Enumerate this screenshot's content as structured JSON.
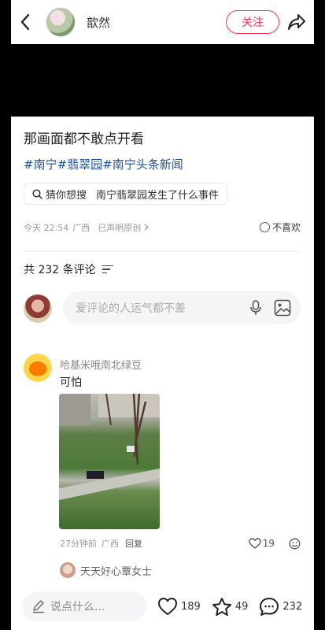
{
  "header": {
    "username": "歆然",
    "follow_label": "关注"
  },
  "post": {
    "title": "那画面都不敢点开看",
    "hashtags": [
      "#南宁",
      "#翡翠园",
      "#南宁头条新闻"
    ],
    "search_label": "猜你想搜",
    "search_query": "南宁翡翠园发生了什么事件",
    "time": "今天 22:54",
    "region": "广西",
    "original": "已声明原创",
    "dislike_label": "不喜欢"
  },
  "comments": {
    "count_label": "共 232 条评论",
    "input_placeholder": "爱评论的人运气都不差",
    "items": [
      {
        "name": "哈基米哦南北绿豆",
        "text": "可怕",
        "time": "27分钟前",
        "region": "广西",
        "reply_label": "回复",
        "likes": "19",
        "sub_reply_name": "天天好心覃女士"
      }
    ]
  },
  "bottom": {
    "say_placeholder": "说点什么...",
    "likes": "189",
    "favorites": "49",
    "comments": "232"
  },
  "colors": {
    "accent": "#ff2d55",
    "hashtag": "#1e4f9c"
  }
}
